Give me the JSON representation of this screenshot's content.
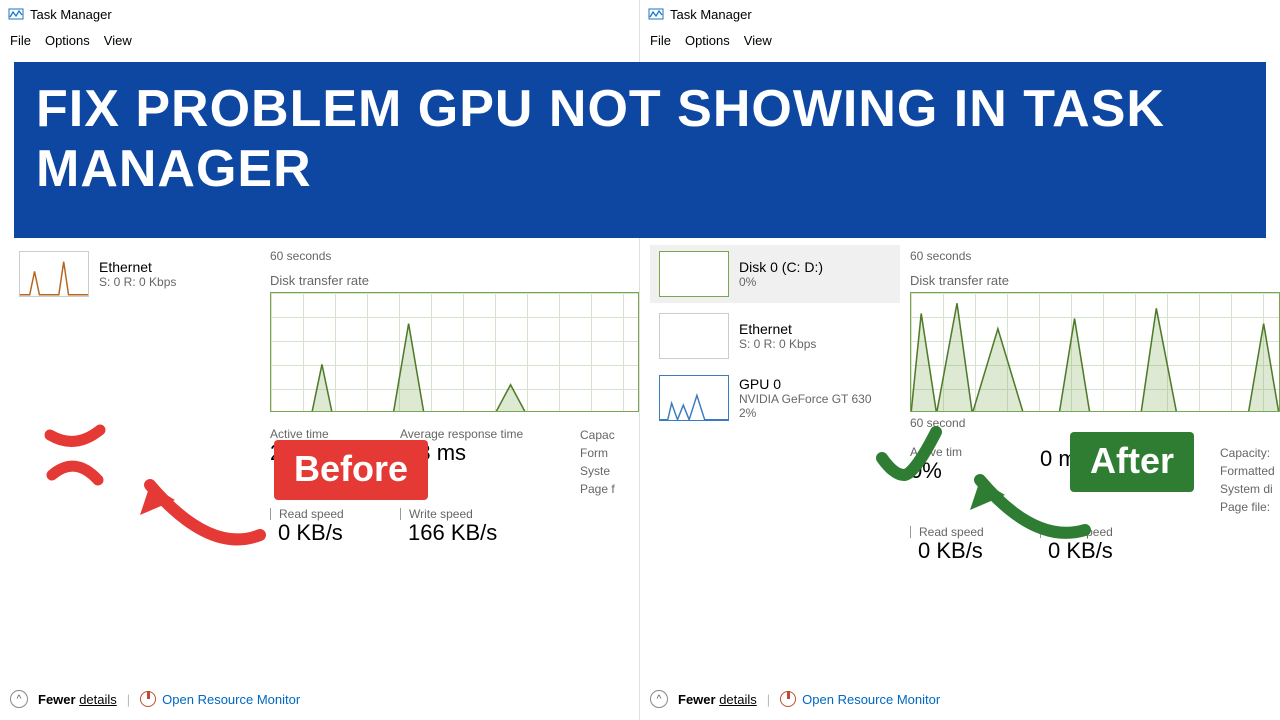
{
  "app": {
    "title": "Task Manager"
  },
  "menus": {
    "file": "File",
    "options": "Options",
    "view": "View"
  },
  "banner": {
    "text": "FIX PROBLEM GPU NOT SHOWING IN TASK MANAGER"
  },
  "tags": {
    "before": "Before",
    "after": "After"
  },
  "left": {
    "sidebar": {
      "ethernet": {
        "name": "Ethernet",
        "value": "S: 0 R: 0 Kbps"
      }
    },
    "pane": {
      "axis_sixty": "60 seconds",
      "chart_title": "Disk transfer rate",
      "active_time": {
        "label": "Active time",
        "value": "2%"
      },
      "avg_resp": {
        "label": "Average response time",
        "value": "8,3 ms"
      },
      "read": {
        "label": "Read speed",
        "value": "0 KB/s"
      },
      "write": {
        "label": "Write speed",
        "value": "166 KB/s"
      },
      "info": {
        "capacity": "Capac",
        "formatted": "Form",
        "system": "Syste",
        "page": "Page f"
      }
    }
  },
  "right": {
    "sidebar": {
      "disk": {
        "name": "Disk 0 (C: D:)",
        "value": "0%"
      },
      "ethernet": {
        "name": "Ethernet",
        "value": "S: 0 R: 0 Kbps"
      },
      "gpu": {
        "name": "GPU 0",
        "model": "NVIDIA GeForce GT 630",
        "value": "2%"
      }
    },
    "pane": {
      "axis_sixty": "60 seconds",
      "chart_title": "Disk transfer rate",
      "axis_sixty2": "60 second",
      "active_time": {
        "label": "Active tim",
        "value": "0%"
      },
      "avg_resp": {
        "label": "",
        "value": "0 ms"
      },
      "read": {
        "label": "Read speed",
        "value": "0 KB/s"
      },
      "write": {
        "label": "Write speed",
        "value": "0 KB/s"
      },
      "info": {
        "capacity": "Capacity:",
        "formatted": "Formatted",
        "system": "System di",
        "page": "Page file:"
      }
    }
  },
  "footer": {
    "fewer_a": "Fewer ",
    "fewer_b": "details",
    "orm": "Open Resource Monitor"
  }
}
